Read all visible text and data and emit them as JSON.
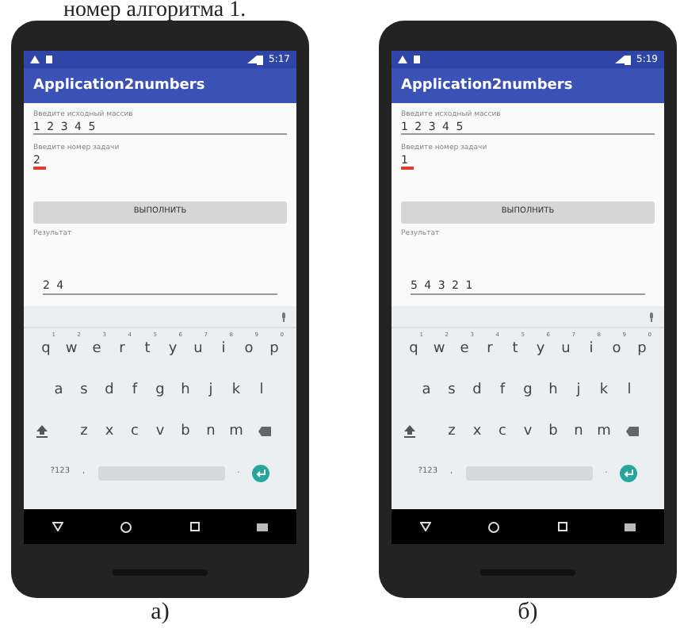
{
  "heading": "номер алгоритма 1.",
  "phones": [
    {
      "caption": "а)",
      "time": "5:17",
      "app_title": "Application2numbers",
      "fields": [
        {
          "label": "Введите исходный массив",
          "value": "1 2 3 4 5",
          "focused": false
        },
        {
          "label": "Введите номер задачи",
          "value": "2",
          "focused": true
        }
      ],
      "button": "ВЫПОЛНИТЬ",
      "result_label": "Результат",
      "result": "2 4",
      "keyboard": {
        "rows": [
          [
            {
              "key": "q",
              "hint": "1"
            },
            {
              "key": "w",
              "hint": "2"
            },
            {
              "key": "e",
              "hint": "3"
            },
            {
              "key": "r",
              "hint": "4"
            },
            {
              "key": "t",
              "hint": "5"
            },
            {
              "key": "y",
              "hint": "6"
            },
            {
              "key": "u",
              "hint": "7"
            },
            {
              "key": "i",
              "hint": "8"
            },
            {
              "key": "o",
              "hint": "9"
            },
            {
              "key": "p",
              "hint": "0"
            }
          ],
          [
            {
              "key": "a"
            },
            {
              "key": "s"
            },
            {
              "key": "d"
            },
            {
              "key": "f"
            },
            {
              "key": "g"
            },
            {
              "key": "h"
            },
            {
              "key": "j"
            },
            {
              "key": "k"
            },
            {
              "key": "l"
            }
          ],
          [
            {
              "key": "z"
            },
            {
              "key": "x"
            },
            {
              "key": "c"
            },
            {
              "key": "v"
            },
            {
              "key": "b"
            },
            {
              "key": "n"
            },
            {
              "key": "m"
            }
          ]
        ],
        "symbols": "?123",
        "comma": ",",
        "period": "."
      }
    },
    {
      "caption": "б)",
      "time": "5:19",
      "app_title": "Application2numbers",
      "fields": [
        {
          "label": "Введите исходный массив",
          "value": "1 2 3 4 5",
          "focused": false
        },
        {
          "label": "Введите номер задачи",
          "value": "1",
          "focused": true
        }
      ],
      "button": "ВЫПОЛНИТЬ",
      "result_label": "Результат",
      "result": "5 4 3 2 1",
      "keyboard": {
        "rows": [
          [
            {
              "key": "q",
              "hint": "1"
            },
            {
              "key": "w",
              "hint": "2"
            },
            {
              "key": "e",
              "hint": "3"
            },
            {
              "key": "r",
              "hint": "4"
            },
            {
              "key": "t",
              "hint": "5"
            },
            {
              "key": "y",
              "hint": "6"
            },
            {
              "key": "u",
              "hint": "7"
            },
            {
              "key": "i",
              "hint": "8"
            },
            {
              "key": "o",
              "hint": "9"
            },
            {
              "key": "p",
              "hint": "0"
            }
          ],
          [
            {
              "key": "a"
            },
            {
              "key": "s"
            },
            {
              "key": "d"
            },
            {
              "key": "f"
            },
            {
              "key": "g"
            },
            {
              "key": "h"
            },
            {
              "key": "j"
            },
            {
              "key": "k"
            },
            {
              "key": "l"
            }
          ],
          [
            {
              "key": "z"
            },
            {
              "key": "x"
            },
            {
              "key": "c"
            },
            {
              "key": "v"
            },
            {
              "key": "b"
            },
            {
              "key": "n"
            },
            {
              "key": "m"
            }
          ]
        ],
        "symbols": "?123",
        "comma": ",",
        "period": "."
      }
    }
  ]
}
